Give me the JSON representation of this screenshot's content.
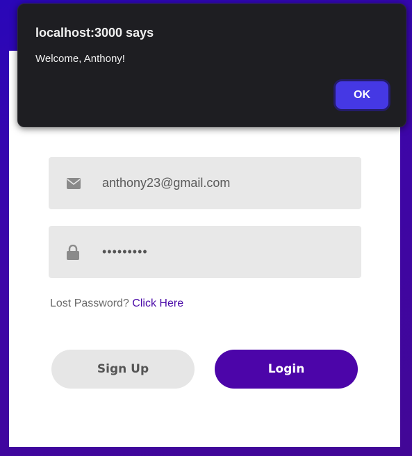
{
  "form": {
    "email_value": "anthony23@gmail.com",
    "password_value": "•••••••••",
    "lost_password_text": "Lost Password?",
    "lost_password_link": "Click Here",
    "signup_label": "Sign Up",
    "login_label": "Login"
  },
  "icons": {
    "email": "envelope-icon",
    "password": "lock-icon"
  },
  "dialog": {
    "title": "localhost:3000 says",
    "message": "Welcome, Anthony!",
    "ok_label": "OK"
  },
  "colors": {
    "accent": "#4c05a9",
    "dialog_button": "#4538e4",
    "background_gradient_start": "#2a07b8",
    "background_gradient_end": "#420796"
  }
}
